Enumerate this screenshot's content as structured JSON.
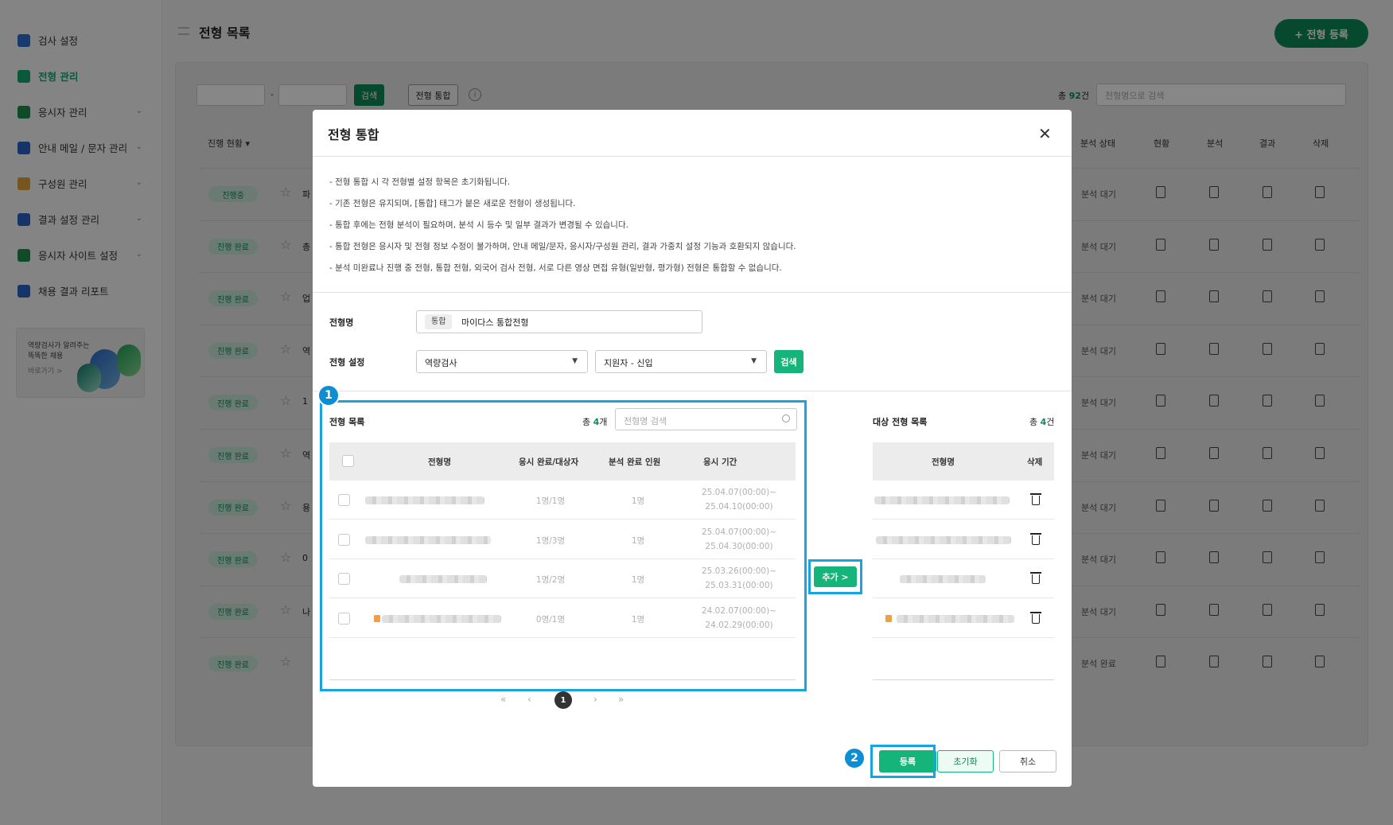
{
  "sidebar": {
    "items": [
      {
        "label": "검사 설정",
        "icon": "puzzle-icon",
        "color": "#2f6fd0",
        "chevron": false
      },
      {
        "label": "전형 관리",
        "icon": "cubes-icon",
        "color": "#11a96f",
        "chevron": false,
        "active": true
      },
      {
        "label": "응시자 관리",
        "icon": "user-card-icon",
        "color": "#1f8f4a",
        "chevron": true
      },
      {
        "label": "안내 메일 / 문자 관리",
        "icon": "mail-icon",
        "color": "#2b63c4",
        "chevron": true
      },
      {
        "label": "구성원 관리",
        "icon": "people-icon",
        "color": "#e0a23a",
        "chevron": true
      },
      {
        "label": "결과 설정 관리",
        "icon": "checklist-icon",
        "color": "#2b63c4",
        "chevron": true
      },
      {
        "label": "응시자 사이트 설정",
        "icon": "site-icon",
        "color": "#1f8f4a",
        "chevron": true
      },
      {
        "label": "채용 결과 리포트",
        "icon": "report-icon",
        "color": "#2b63c4",
        "chevron": false
      }
    ],
    "promo": {
      "line1": "역량검사가 알려주는",
      "line2": "똑똑한 채용",
      "link": "바로가기 >"
    }
  },
  "header": {
    "title": "전형 목록",
    "register_button": "+ 전형 등록"
  },
  "toolbar": {
    "date_sep": "-",
    "search": "검색",
    "merge": "전형 통합",
    "info": "i",
    "total_prefix": "총 ",
    "total_num": "92",
    "total_suffix": "건",
    "search_placeholder": "전형명으로 검색"
  },
  "table_bg": {
    "headers": {
      "progress": "진행 현황 ▾",
      "analysis_status": "분석 상태",
      "status": "현황",
      "analysis": "분석",
      "result": "결과",
      "delete": "삭제"
    },
    "rows": [
      {
        "status": "진행중",
        "lead": "파",
        "analysis": "분석 대기"
      },
      {
        "status": "진행 완료",
        "lead": "총",
        "analysis": "분석 대기"
      },
      {
        "status": "진행 완료",
        "lead": "업",
        "analysis": "분석 대기"
      },
      {
        "status": "진행 완료",
        "lead": "역",
        "analysis": "분석 대기"
      },
      {
        "status": "진행 완료",
        "lead": "1",
        "analysis": "분석 대기"
      },
      {
        "status": "진행 완료",
        "lead": "역",
        "analysis": "분석 대기"
      },
      {
        "status": "진행 완료",
        "lead": "용",
        "analysis": "분석 대기"
      },
      {
        "status": "진행 완료",
        "lead": "0",
        "analysis": "분석 대기"
      },
      {
        "status": "진행 완료",
        "lead": "나",
        "analysis": "분석 대기"
      },
      {
        "status": "진행 완료",
        "lead": "",
        "analysis": "분석 완료"
      }
    ]
  },
  "modal": {
    "title": "전형 통합",
    "close": "✕",
    "notices": [
      "- 전형 통합 시 각 전형별 설정 항목은 초기화됩니다.",
      "- 기존 전형은 유지되며, [통합] 태그가 붙은 새로운 전형이 생성됩니다.",
      "- 통합 후에는 전형 분석이 필요하며, 분석 시 등수 및 일부 결과가 변경될 수 있습니다.",
      "- 통합 전형은 응시자 및 전형 정보 수정이 불가하며, 안내 메일/문자, 응시자/구성원 관리, 결과 가중치 설정 기능과 호환되지 않습니다.",
      "- 분석 미완료나 진행 중 전형, 통합 전형, 외국어 검사 전형, 서로 다른 영상 면접 유형(일반형, 평가형) 전형은 통합할 수 없습니다."
    ],
    "name_label": "전형명",
    "name_tag": "통합",
    "name_value": "마이다스 통합전형",
    "setting_label": "전형 설정",
    "select1": "역량검사",
    "select2": "지원자 - 신입",
    "search": "검색",
    "left": {
      "title": "전형 목록",
      "count_prefix": "총 ",
      "count_num": "4",
      "count_suffix": "개",
      "search_placeholder": "전형명 검색",
      "headers": {
        "name": "전형명",
        "done": "응시 완료/대상자",
        "analyzed": "분석 완료 인원",
        "period": "응시 기간"
      },
      "rows": [
        {
          "done": "1명/1명",
          "analyzed": "1명",
          "period1": "25.04.07(00:00)~",
          "period2": "25.04.10(00:00)"
        },
        {
          "done": "1명/3명",
          "analyzed": "1명",
          "period1": "25.04.07(00:00)~",
          "period2": "25.04.30(00:00)"
        },
        {
          "done": "1명/2명",
          "analyzed": "1명",
          "period1": "25.03.26(00:00)~",
          "period2": "25.03.31(00:00)"
        },
        {
          "done": "0명/1명",
          "analyzed": "1명",
          "period1": "24.02.07(00:00)~",
          "period2": "24.02.29(00:00)"
        }
      ]
    },
    "add_button": "추가 >",
    "right": {
      "title": "대상 전형 목록",
      "count_prefix": "총 ",
      "count_num": "4",
      "count_suffix": "건",
      "headers": {
        "name": "전형명",
        "delete": "삭제"
      }
    },
    "pager": {
      "first": "«",
      "prev": "‹",
      "current": "1",
      "next": "›",
      "last": "»"
    },
    "callouts": {
      "one": "1",
      "two": "2"
    },
    "footer": {
      "register": "등록",
      "reset": "초기화",
      "cancel": "취소"
    }
  },
  "colors": {
    "accent": "#14b47a",
    "brand_dark": "#0d8a5a",
    "highlight": "#18a4e0"
  }
}
